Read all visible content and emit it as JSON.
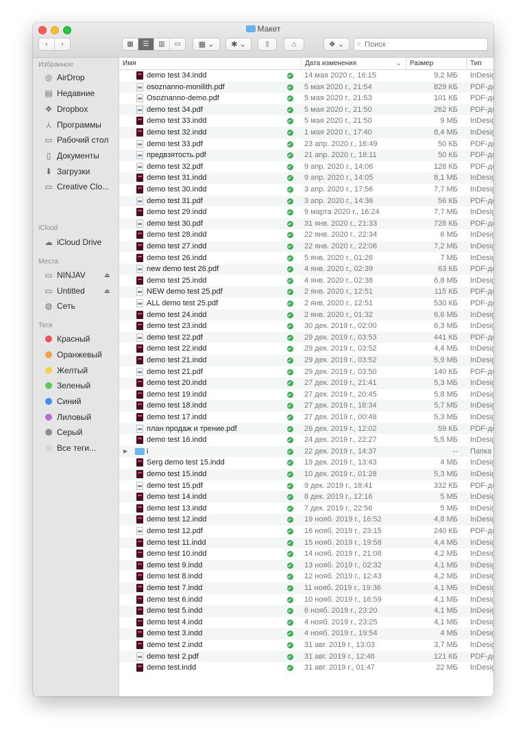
{
  "window": {
    "title": "Макет"
  },
  "toolbar": {
    "back_label": "‹",
    "forward_label": "›",
    "view_icons": "▦",
    "view_list": "☰",
    "view_columns": "▥",
    "view_gallery": "▭",
    "group_label": "▦ ⌄",
    "action_label": "✱ ⌄",
    "share_label": "⇧",
    "tag_label": "⌂",
    "dropbox_label": "❖ ⌄",
    "search_placeholder": "Поиск"
  },
  "sidebar": {
    "favorites_label": "Избранное",
    "favorites": [
      {
        "label": "AirDrop",
        "icon": "airdrop-icon"
      },
      {
        "label": "Недавние",
        "icon": "recents-icon"
      },
      {
        "label": "Dropbox",
        "icon": "dropbox-icon"
      },
      {
        "label": "Программы",
        "icon": "applications-icon"
      },
      {
        "label": "Рабочий стол",
        "icon": "desktop-icon"
      },
      {
        "label": "Документы",
        "icon": "documents-icon"
      },
      {
        "label": "Загрузки",
        "icon": "downloads-icon"
      },
      {
        "label": "Creative Clo...",
        "icon": "folder-icon"
      }
    ],
    "icloud_label": "iCloud",
    "icloud": [
      {
        "label": "iCloud Drive",
        "icon": "cloud-icon"
      }
    ],
    "places_label": "Места",
    "places": [
      {
        "label": "NINJAV",
        "icon": "disk-icon",
        "eject": "⏏"
      },
      {
        "label": "Untitled",
        "icon": "disk-icon",
        "eject": "⏏"
      },
      {
        "label": "Сеть",
        "icon": "network-icon"
      }
    ],
    "tags_label": "Теги",
    "tags": [
      {
        "label": "Красный",
        "color": "#f0504f"
      },
      {
        "label": "Оранжевый",
        "color": "#f5a041"
      },
      {
        "label": "Желтый",
        "color": "#f6d044"
      },
      {
        "label": "Зеленый",
        "color": "#5dc950"
      },
      {
        "label": "Синий",
        "color": "#3e8ef2"
      },
      {
        "label": "Лиловый",
        "color": "#b26fd6"
      },
      {
        "label": "Серый",
        "color": "#8e8e93"
      },
      {
        "label": "Все теги...",
        "color": "#d8d8d8"
      }
    ]
  },
  "columns": {
    "name": "Имя",
    "date": "Дата изменения",
    "size": "Размер",
    "type": "Тип"
  },
  "files": [
    {
      "name": "demo test 34.indd",
      "date": "14 мая 2020 г., 16:15",
      "size": "9,2 МБ",
      "type": "InDesig",
      "kind": "indd"
    },
    {
      "name": "osoznanno-monilith.pdf",
      "date": "5 мая 2020 г., 21:54",
      "size": "829 КБ",
      "type": "PDF-до",
      "kind": "pdf"
    },
    {
      "name": "Osoznanno-demo.pdf",
      "date": "5 мая 2020 г., 21:53",
      "size": "101 КБ",
      "type": "PDF-до",
      "kind": "pdf"
    },
    {
      "name": "demo test 34.pdf",
      "date": "5 мая 2020 г., 21:50",
      "size": "262 КБ",
      "type": "PDF-до",
      "kind": "pdf"
    },
    {
      "name": "demo test 33.indd",
      "date": "5 мая 2020 г., 21:50",
      "size": "9 МБ",
      "type": "InDesig",
      "kind": "indd"
    },
    {
      "name": "demo test 32.indd",
      "date": "1 мая 2020 г., 17:40",
      "size": "8,4 МБ",
      "type": "InDesig",
      "kind": "indd"
    },
    {
      "name": "demo test 33.pdf",
      "date": "23 апр. 2020 г., 16:49",
      "size": "50 КБ",
      "type": "PDF-до",
      "kind": "pdf"
    },
    {
      "name": "предвзятость.pdf",
      "date": "21 апр. 2020 г., 18:11",
      "size": "50 КБ",
      "type": "PDF-до",
      "kind": "pdf"
    },
    {
      "name": "demo test 32.pdf",
      "date": "9 апр. 2020 г., 14:06",
      "size": "128 КБ",
      "type": "PDF-до",
      "kind": "pdf"
    },
    {
      "name": "demo test 31.indd",
      "date": "9 апр. 2020 г., 14:05",
      "size": "8,1 МБ",
      "type": "InDesig",
      "kind": "indd"
    },
    {
      "name": "demo test 30.indd",
      "date": "3 апр. 2020 г., 17:56",
      "size": "7,7 МБ",
      "type": "InDesig",
      "kind": "indd"
    },
    {
      "name": "demo test 31.pdf",
      "date": "3 апр. 2020 г., 14:36",
      "size": "56 КБ",
      "type": "PDF-до",
      "kind": "pdf"
    },
    {
      "name": "demo test 29.indd",
      "date": "9 марта 2020 г., 16:24",
      "size": "7,7 МБ",
      "type": "InDesig",
      "kind": "indd"
    },
    {
      "name": "demo test 30.pdf",
      "date": "31 янв. 2020 г., 21:33",
      "size": "728 КБ",
      "type": "PDF-до",
      "kind": "pdf"
    },
    {
      "name": "demo test 28.indd",
      "date": "22 янв. 2020 г., 22:34",
      "size": "6 МБ",
      "type": "InDesig",
      "kind": "indd"
    },
    {
      "name": "demo test 27.indd",
      "date": "22 янв. 2020 г., 22:06",
      "size": "7,2 МБ",
      "type": "InDesig",
      "kind": "indd"
    },
    {
      "name": "demo test 26.indd",
      "date": "5 янв. 2020 г., 01:26",
      "size": "7 МБ",
      "type": "InDesig",
      "kind": "indd"
    },
    {
      "name": "new demo test 26.pdf",
      "date": "4 янв. 2020 г., 02:39",
      "size": "63 КБ",
      "type": "PDF-до",
      "kind": "pdf"
    },
    {
      "name": "demo test 25.indd",
      "date": "4 янв. 2020 г., 02:38",
      "size": "6,8 МБ",
      "type": "InDesig",
      "kind": "indd"
    },
    {
      "name": "NEW demo test 25.pdf",
      "date": "2 янв. 2020 г., 12:51",
      "size": "115 КБ",
      "type": "PDF-до",
      "kind": "pdf"
    },
    {
      "name": "ALL demo test 25.pdf",
      "date": "2 янв. 2020 г., 12:51",
      "size": "530 КБ",
      "type": "PDF-до",
      "kind": "pdf"
    },
    {
      "name": "demo test 24.indd",
      "date": "2 янв. 2020 г., 01:32",
      "size": "6,6 МБ",
      "type": "InDesig",
      "kind": "indd"
    },
    {
      "name": "demo test 23.indd",
      "date": "30 дек. 2019 г., 02:00",
      "size": "6,3 МБ",
      "type": "InDesig",
      "kind": "indd"
    },
    {
      "name": "demo test 22.pdf",
      "date": "29 дек. 2019 г., 03:53",
      "size": "441 КБ",
      "type": "PDF-до",
      "kind": "pdf"
    },
    {
      "name": "demo test 22.indd",
      "date": "29 дек. 2019 г., 03:52",
      "size": "4,4 МБ",
      "type": "InDesig",
      "kind": "indd"
    },
    {
      "name": "demo test 21.indd",
      "date": "29 дек. 2019 г., 03:52",
      "size": "5,9 МБ",
      "type": "InDesig",
      "kind": "indd"
    },
    {
      "name": "demo test 21.pdf",
      "date": "29 дек. 2019 г., 03:50",
      "size": "140 КБ",
      "type": "PDF-до",
      "kind": "pdf"
    },
    {
      "name": "demo test 20.indd",
      "date": "27 дек. 2019 г., 21:41",
      "size": "5,3 МБ",
      "type": "InDesig",
      "kind": "indd"
    },
    {
      "name": "demo test 19.indd",
      "date": "27 дек. 2019 г., 20:45",
      "size": "5,8 МБ",
      "type": "InDesig",
      "kind": "indd"
    },
    {
      "name": "demo test 18.indd",
      "date": "27 дек. 2019 г., 18:34",
      "size": "5,7 МБ",
      "type": "InDesig",
      "kind": "indd"
    },
    {
      "name": "demo test 17.indd",
      "date": "27 дек. 2019 г., 00:48",
      "size": "5,3 МБ",
      "type": "InDesig",
      "kind": "indd"
    },
    {
      "name": "план продаж и трение.pdf",
      "date": "26 дек. 2019 г., 12:02",
      "size": "59 КБ",
      "type": "PDF-до",
      "kind": "pdf"
    },
    {
      "name": "demo test 16.indd",
      "date": "24 дек. 2019 г., 22:27",
      "size": "5,5 МБ",
      "type": "InDesig",
      "kind": "indd"
    },
    {
      "name": "i",
      "date": "22 дек. 2019 г., 14:37",
      "size": "--",
      "type": "Папка",
      "kind": "folder"
    },
    {
      "name": "Serg demo test 15.indd",
      "date": "19 дек. 2019 г., 13:43",
      "size": "4 МБ",
      "type": "InDesig",
      "kind": "indd"
    },
    {
      "name": "demo test 15.indd",
      "date": "10 дек. 2019 г., 01:28",
      "size": "5,3 МБ",
      "type": "InDesig",
      "kind": "indd"
    },
    {
      "name": "demo test 15.pdf",
      "date": "9 дек. 2019 г., 18:41",
      "size": "332 КБ",
      "type": "PDF-до",
      "kind": "pdf"
    },
    {
      "name": "demo test 14.indd",
      "date": "8 дек. 2019 г., 12:16",
      "size": "5 МБ",
      "type": "InDesig",
      "kind": "indd"
    },
    {
      "name": "demo test 13.indd",
      "date": "7 дек. 2019 г., 22:56",
      "size": "5 МБ",
      "type": "InDesig",
      "kind": "indd"
    },
    {
      "name": "demo test 12.indd",
      "date": "19 нояб. 2019 г., 16:52",
      "size": "4,8 МБ",
      "type": "InDesig",
      "kind": "indd"
    },
    {
      "name": "demo test 12.pdf",
      "date": "16 нояб. 2019 г., 23:15",
      "size": "240 КБ",
      "type": "PDF-до",
      "kind": "pdf"
    },
    {
      "name": "demo test 11.indd",
      "date": "15 нояб. 2019 г., 19:58",
      "size": "4,4 МБ",
      "type": "InDesig",
      "kind": "indd"
    },
    {
      "name": "demo test 10.indd",
      "date": "14 нояб. 2019 г., 21:08",
      "size": "4,2 МБ",
      "type": "InDesig",
      "kind": "indd"
    },
    {
      "name": "demo test 9.indd",
      "date": "13 нояб. 2019 г., 02:32",
      "size": "4,1 МБ",
      "type": "InDesig",
      "kind": "indd"
    },
    {
      "name": "demo test 8.indd",
      "date": "12 нояб. 2019 г., 12:43",
      "size": "4,2 МБ",
      "type": "InDesig",
      "kind": "indd"
    },
    {
      "name": "demo test 7.indd",
      "date": "11 нояб. 2019 г., 19:36",
      "size": "4,1 МБ",
      "type": "InDesig",
      "kind": "indd"
    },
    {
      "name": "demo test 6.indd",
      "date": "10 нояб. 2019 г., 16:59",
      "size": "4,1 МБ",
      "type": "InDesig",
      "kind": "indd"
    },
    {
      "name": "demo test 5.indd",
      "date": "6 нояб. 2019 г., 23:20",
      "size": "4,1 МБ",
      "type": "InDesig",
      "kind": "indd"
    },
    {
      "name": "demo test 4.indd",
      "date": "4 нояб. 2019 г., 23:25",
      "size": "4,1 МБ",
      "type": "InDesig",
      "kind": "indd"
    },
    {
      "name": "demo test 3.indd",
      "date": "4 нояб. 2019 г., 19:54",
      "size": "4 МБ",
      "type": "InDesig",
      "kind": "indd"
    },
    {
      "name": "demo test 2.indd",
      "date": "31 авг. 2019 г., 13:03",
      "size": "3,7 МБ",
      "type": "InDesig",
      "kind": "indd"
    },
    {
      "name": "demo test 2.pdf",
      "date": "31 авг. 2019 г., 12:46",
      "size": "121 КБ",
      "type": "PDF-до",
      "kind": "pdf"
    },
    {
      "name": "demo test.indd",
      "date": "31 авг. 2019 г., 01:47",
      "size": "22 МБ",
      "type": "InDesig",
      "kind": "indd"
    }
  ]
}
